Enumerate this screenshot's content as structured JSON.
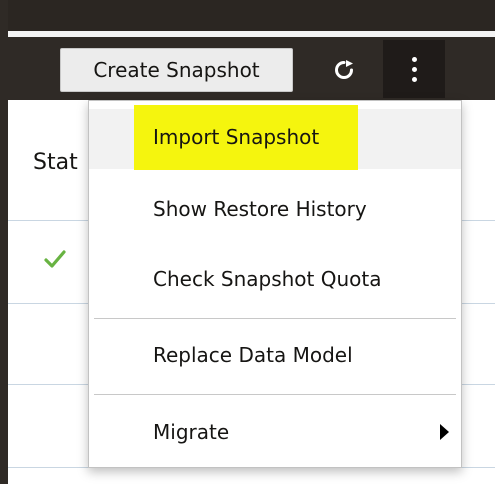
{
  "toolbar": {
    "create_label": "Create Snapshot",
    "refresh_icon": "refresh-icon",
    "more_icon": "more-vertical-icon"
  },
  "table": {
    "header": "Stat",
    "first_row_status_icon": "checkmark-icon"
  },
  "menu": {
    "items": [
      {
        "label": "Import Snapshot",
        "highlighted": true
      },
      {
        "label": "Show Restore History"
      },
      {
        "label": "Check Snapshot Quota"
      },
      {
        "label": "Replace Data Model"
      },
      {
        "label": "Migrate",
        "has_submenu": true
      }
    ]
  },
  "colors": {
    "toolbar_bg": "#2f2a26",
    "highlight": "#f5f50e",
    "check_green": "#68b342",
    "row_divider": "#c9d6e2"
  }
}
